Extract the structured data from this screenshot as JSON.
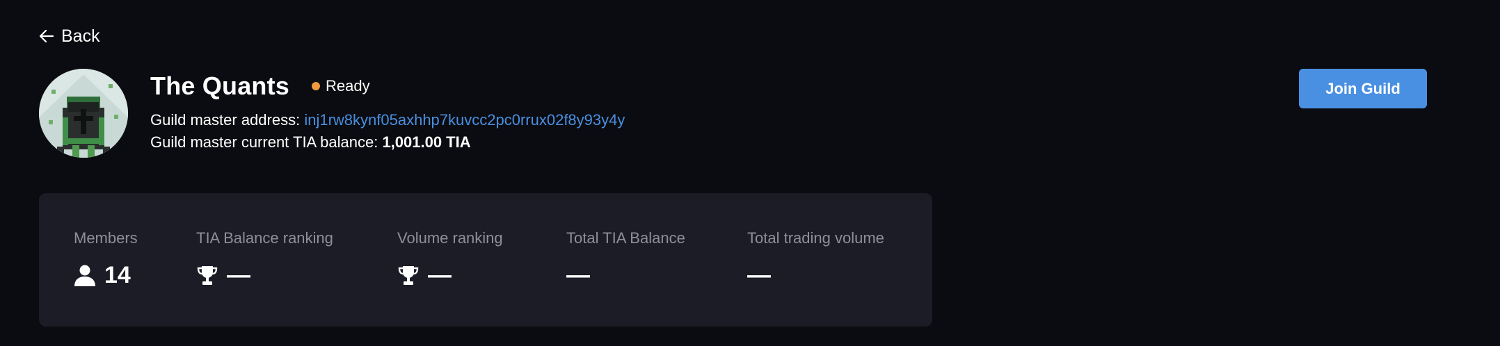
{
  "nav": {
    "back_label": "Back"
  },
  "guild": {
    "name": "The Quants",
    "status": "Ready",
    "status_color": "#f09a3e",
    "master_address_label": "Guild master address:",
    "master_address": "inj1rw8kynf05axhhp7kuvcc2pc0rrux02f8y93y4y",
    "master_balance_label": "Guild master current TIA balance:",
    "master_balance": "1,001.00 TIA"
  },
  "actions": {
    "join_label": "Join Guild"
  },
  "stats": {
    "members": {
      "label": "Members",
      "value": "14",
      "icon": "user-icon"
    },
    "tia_balance_ranking": {
      "label": "TIA Balance ranking",
      "value": "—",
      "icon": "trophy-icon"
    },
    "volume_ranking": {
      "label": "Volume ranking",
      "value": "—",
      "icon": "trophy-icon"
    },
    "total_tia_balance": {
      "label": "Total TIA Balance",
      "value": "—"
    },
    "total_trading_volume": {
      "label": "Total trading volume",
      "value": "—"
    }
  },
  "colors": {
    "background": "#0b0c11",
    "card": "#1b1c26",
    "accent": "#4a90e2",
    "link": "#4a8fe0",
    "muted_text": "#8e8f99"
  }
}
